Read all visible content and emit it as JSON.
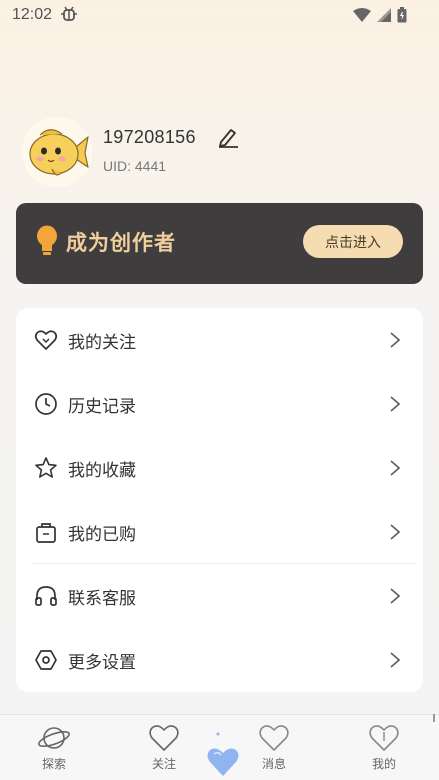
{
  "status_bar": {
    "time": "12:02",
    "icons": [
      "debug-icon",
      "wifi-icon",
      "signal-icon",
      "battery-icon"
    ]
  },
  "profile": {
    "user_id": "197208156",
    "uid_label": "UID: 4441",
    "avatar": "fish-avatar"
  },
  "creator_banner": {
    "title": "成为创作者",
    "button_label": "点击进入",
    "colors": {
      "background": "#3f3d3d",
      "title": "#f1cf9d",
      "button": "#f6dcb1"
    }
  },
  "menu": {
    "items": [
      {
        "label": "我的关注",
        "icon": "heart-icon"
      },
      {
        "label": "历史记录",
        "icon": "clock-icon"
      },
      {
        "label": "我的收藏",
        "icon": "star-icon"
      },
      {
        "label": "我的已购",
        "icon": "shopping-bag-icon"
      },
      {
        "label": "联系客服",
        "icon": "headphones-icon"
      },
      {
        "label": "更多设置",
        "icon": "settings-hexagon-icon"
      }
    ]
  },
  "bottom_nav": {
    "items": [
      {
        "label": "探索",
        "icon": "planet-icon"
      },
      {
        "label": "关注",
        "icon": "heart-outline-icon"
      },
      {
        "label": "",
        "icon": "center-heart-icon"
      },
      {
        "label": "消息",
        "icon": "message-heart-icon"
      },
      {
        "label": "我的",
        "icon": "profile-heart-icon"
      }
    ],
    "accent": "#8fb4f0"
  }
}
